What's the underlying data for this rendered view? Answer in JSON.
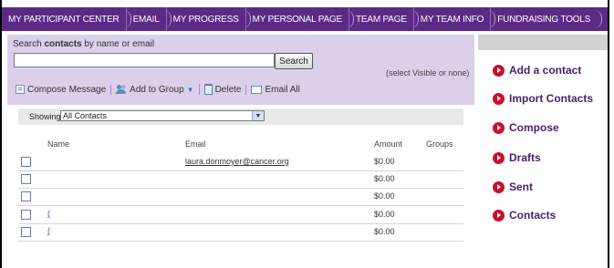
{
  "nav": {
    "tabs": [
      "MY PARTICIPANT CENTER",
      "EMAIL",
      "MY PROGRESS",
      "MY PERSONAL PAGE",
      "TEAM PAGE",
      "MY TEAM INFO",
      "FUNDRAISING TOOLS"
    ]
  },
  "search": {
    "label_prefix": "Search ",
    "label_bold": "contacts",
    "label_suffix": " by name or email",
    "value": "",
    "button": "Search"
  },
  "select_hint": "(select Visible or none)",
  "toolbar": {
    "compose": "Compose Message",
    "add_group": "Add to Group",
    "delete": "Delete",
    "email_all": "Email All"
  },
  "filter": {
    "label": "Showing",
    "selected": "All Contacts"
  },
  "table": {
    "headers": {
      "name": "Name",
      "email": "Email",
      "amount": "Amount",
      "groups": "Groups"
    },
    "rows": [
      {
        "name": "",
        "email": "laura.donmoyer@cancer.org",
        "amount": "$0.00",
        "groups": ""
      },
      {
        "name": "",
        "email": "",
        "amount": "$0.00",
        "groups": ""
      },
      {
        "name": "",
        "email": "",
        "amount": "$0.00",
        "groups": ""
      },
      {
        "name": "(",
        "email": "",
        "amount": "$0.00",
        "groups": ""
      },
      {
        "name": "(",
        "email": "",
        "amount": "$0.00",
        "groups": ""
      }
    ]
  },
  "sidebar": {
    "links": [
      "Add a contact",
      "Import Contacts",
      "Compose",
      "Drafts",
      "Sent",
      "Contacts"
    ]
  },
  "colors": {
    "nav_bg": "#5b2a86",
    "panel_bg": "#dccfea",
    "link_color": "#4a1f6e",
    "bullet": "#c8102e"
  }
}
